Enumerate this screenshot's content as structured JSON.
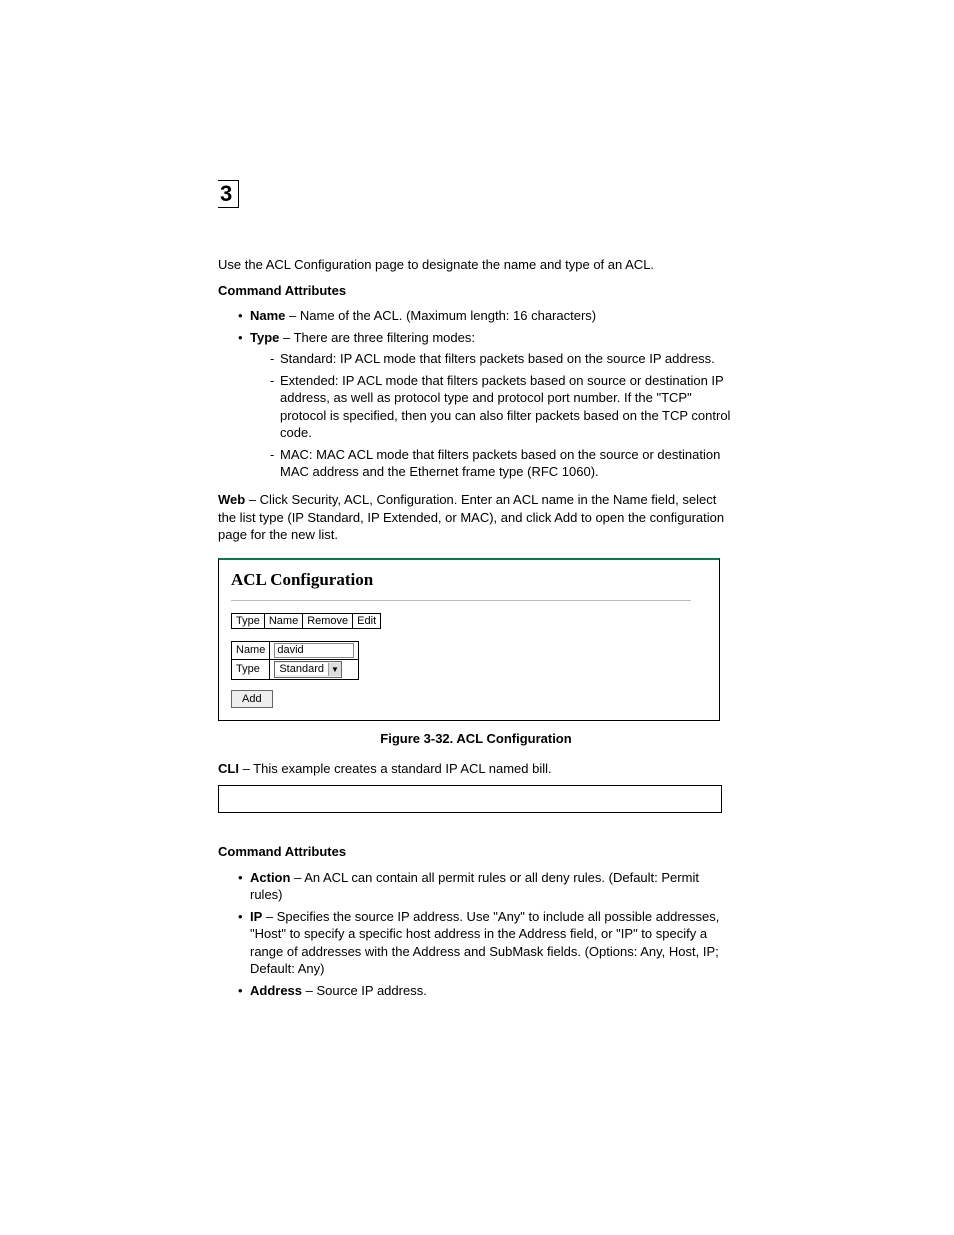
{
  "chapter": "3",
  "intro": "Use the ACL Configuration page to designate the name and type of an ACL.",
  "sec1_heading": "Command Attributes",
  "attr": {
    "name_label": "Name",
    "name_text": " – Name of the ACL. (Maximum length: 16 characters)",
    "type_label": "Type",
    "type_text": " – There are three filtering modes:",
    "mode_standard": "Standard: IP ACL mode that filters packets based on the source IP address.",
    "mode_extended": "Extended: IP ACL mode that filters packets based on source or destination IP address, as well as protocol type and protocol port number. If the \"TCP\" protocol is specified, then you can also filter packets based on the TCP control code.",
    "mode_mac": "MAC: MAC ACL mode that filters packets based on the source or destination MAC address and the Ethernet frame type (RFC 1060)."
  },
  "web": {
    "label": "Web",
    "text": " – Click Security, ACL, Configuration. Enter an ACL name in the Name field, select the list type (IP Standard, IP Extended, or MAC), and click Add to open the configuration page for the new list."
  },
  "figure": {
    "title": "ACL Configuration",
    "headers": {
      "type": "Type",
      "name": "Name",
      "remove": "Remove",
      "edit": "Edit"
    },
    "form": {
      "name_label": "Name",
      "name_value": "david",
      "type_label": "Type",
      "type_value": "Standard"
    },
    "button": "Add",
    "caption": "Figure 3-32.  ACL Configuration"
  },
  "cli": {
    "label": "CLI",
    "text": " – This example creates a standard IP ACL named bill."
  },
  "sec2_heading": "Command Attributes",
  "attr2": {
    "action_label": "Action",
    "action_text": " – An ACL can contain all permit rules or all deny rules. (Default: Permit rules)",
    "ip_label": "IP",
    "ip_text": " – Specifies the source IP address. Use \"Any\" to include all possible addresses, \"Host\" to specify a specific host address in the Address field, or \"IP\" to specify a range of addresses with the Address and SubMask fields. (Options: Any, Host, IP; Default: Any)",
    "address_label": "Address",
    "address_text": " – Source IP address."
  }
}
